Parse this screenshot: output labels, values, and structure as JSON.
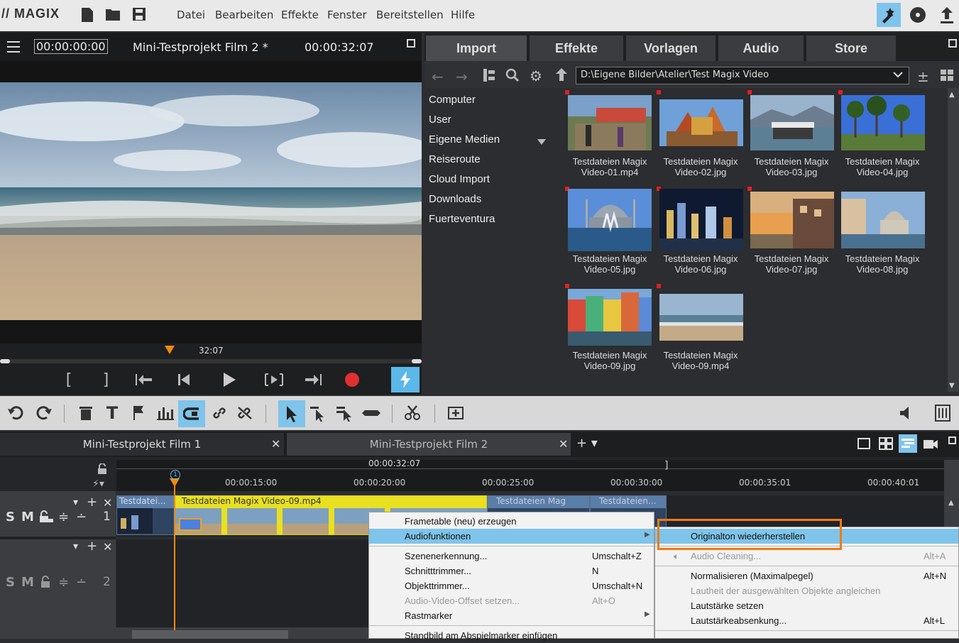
{
  "app": {
    "logo": "// MAGIX"
  },
  "menu": [
    "Datei",
    "Bearbeiten",
    "Effekte",
    "Fenster",
    "Bereitstellen",
    "Hilfe"
  ],
  "preview": {
    "timecode": "00:00:00:00",
    "project_title": "Mini-Testprojekt Film 2 *",
    "duration": "00:00:32:07",
    "marker_time": "32:07"
  },
  "media_tabs": [
    "Import",
    "Effekte",
    "Vorlagen",
    "Audio",
    "Store"
  ],
  "media_path": "D:\\Eigene Bilder\\Atelier\\Test Magix Video",
  "folders": [
    "Computer",
    "User",
    "Eigene Medien",
    "Reiseroute",
    "Cloud Import",
    "Downloads",
    "Fuerteventura"
  ],
  "files": [
    {
      "line1": "Testdateien Magix",
      "line2": "Video-01.mp4"
    },
    {
      "line1": "Testdateien Magix",
      "line2": "Video-02.jpg"
    },
    {
      "line1": "Testdateien Magix",
      "line2": "Video-03.jpg"
    },
    {
      "line1": "Testdateien Magix",
      "line2": "Video-04.jpg"
    },
    {
      "line1": "Testdateien Magix",
      "line2": "Video-05.jpg"
    },
    {
      "line1": "Testdateien Magix",
      "line2": "Video-06.jpg"
    },
    {
      "line1": "Testdateien Magix",
      "line2": "Video-07.jpg"
    },
    {
      "line1": "Testdateien Magix",
      "line2": "Video-08.jpg"
    },
    {
      "line1": "Testdateien Magix",
      "line2": "Video-09.jpg"
    },
    {
      "line1": "Testdateien Magix",
      "line2": "Video-09.mp4"
    }
  ],
  "project_tabs": [
    "Mini-Testprojekt Film 1",
    "Mini-Testprojekt Film 2"
  ],
  "timeline": {
    "end_time": "00:00:32:07",
    "ticks": [
      "00:00:15:00",
      "00:00:20:00",
      "00:00:25:00",
      "00:00:30:00",
      "00:00:35:01",
      "00:00:40:01"
    ],
    "playhead_label": "1",
    "track1_number": "1",
    "track2_number": "2",
    "clips": [
      "Testdatei...",
      "Testdateien Magix Video-09.mp4",
      "Testdateien Mag",
      "Testdateien..."
    ],
    "track_btns": {
      "solo": "S",
      "mute": "M"
    }
  },
  "context_menu": {
    "items": [
      {
        "label": "Frametable (neu) erzeugen",
        "shortcut": ""
      },
      {
        "label": "Audiofunktionen",
        "shortcut": ""
      },
      {
        "label": "Szenenerkennung...",
        "shortcut": "Umschalt+Z"
      },
      {
        "label": "Schnitttrimmer...",
        "shortcut": "N"
      },
      {
        "label": "Objekttrimmer...",
        "shortcut": "Umschalt+N"
      },
      {
        "label": "Audio-Video-Offset setzen...",
        "shortcut": "Alt+O"
      },
      {
        "label": "Rastmarker",
        "shortcut": ""
      },
      {
        "label": "Standbild am Abspielmarker einfügen",
        "shortcut": ""
      }
    ]
  },
  "submenu": {
    "items": [
      {
        "label": "Originalton wiederherstellen",
        "shortcut": ""
      },
      {
        "label": "Audio Cleaning...",
        "shortcut": "Alt+A"
      },
      {
        "label": "Normalisieren (Maximalpegel)",
        "shortcut": "Alt+N"
      },
      {
        "label": "Lautheit der ausgewählten Objekte angleichen",
        "shortcut": ""
      },
      {
        "label": "Lautstärke setzen",
        "shortcut": ""
      },
      {
        "label": "Lautstärkeabsenkung...",
        "shortcut": "Alt+L"
      }
    ]
  },
  "colors": {
    "highlight": "#7fc4ea",
    "orange_box": "#f07a12",
    "accent": "#5bb8e8",
    "record": "#e03030"
  }
}
